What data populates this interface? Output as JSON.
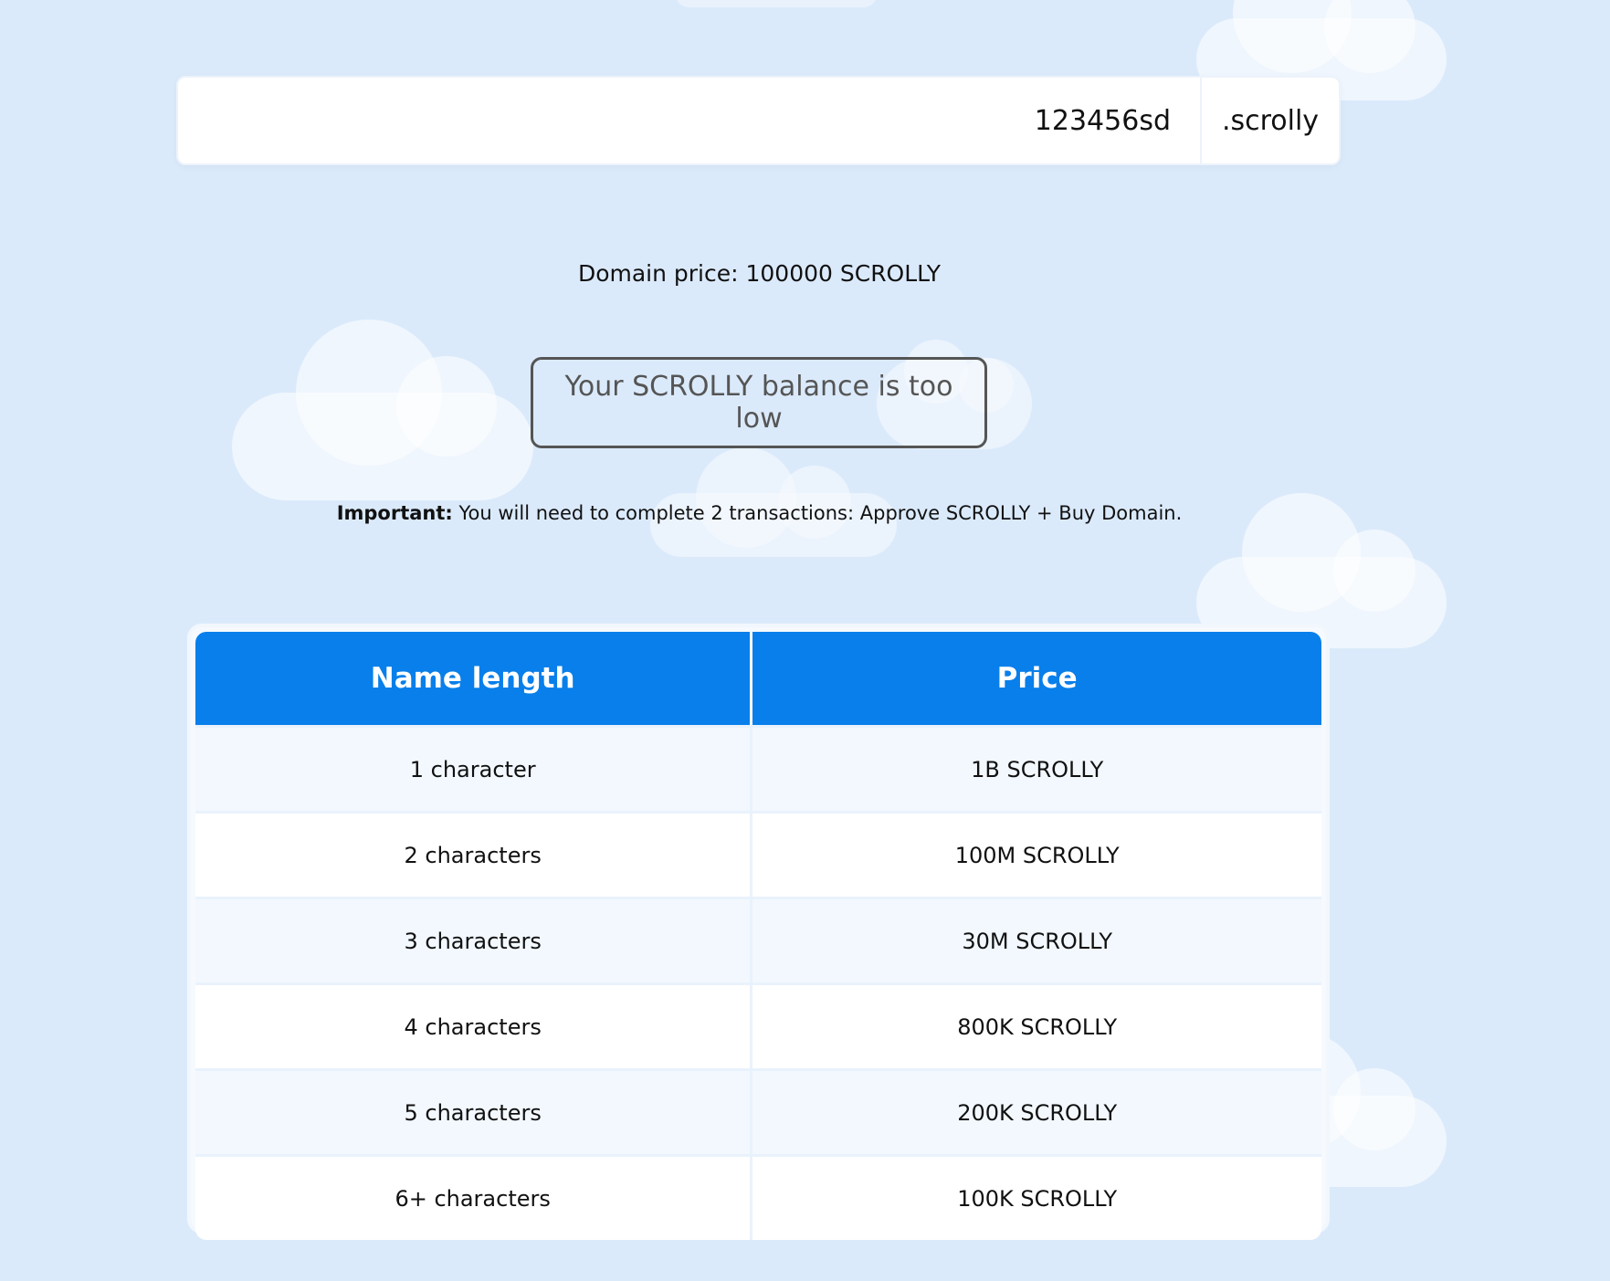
{
  "domain_search": {
    "value": "123456sd",
    "suffix": ".scrolly"
  },
  "price_line": "Domain price: 100000 SCROLLY",
  "status_button": "Your SCROLLY balance is too low",
  "important": {
    "label": "Important:",
    "text": " You will need to complete 2 transactions: Approve SCROLLY + Buy Domain."
  },
  "pricing_table": {
    "headers": [
      "Name length",
      "Price"
    ],
    "rows": [
      [
        "1 character",
        "1B SCROLLY"
      ],
      [
        "2 characters",
        "100M SCROLLY"
      ],
      [
        "3 characters",
        "30M SCROLLY"
      ],
      [
        "4 characters",
        "800K SCROLLY"
      ],
      [
        "5 characters",
        "200K SCROLLY"
      ],
      [
        "6+ characters",
        "100K SCROLLY"
      ]
    ]
  },
  "colors": {
    "background": "#dbeafb",
    "table_header": "#087fea",
    "button_border": "#555555"
  }
}
